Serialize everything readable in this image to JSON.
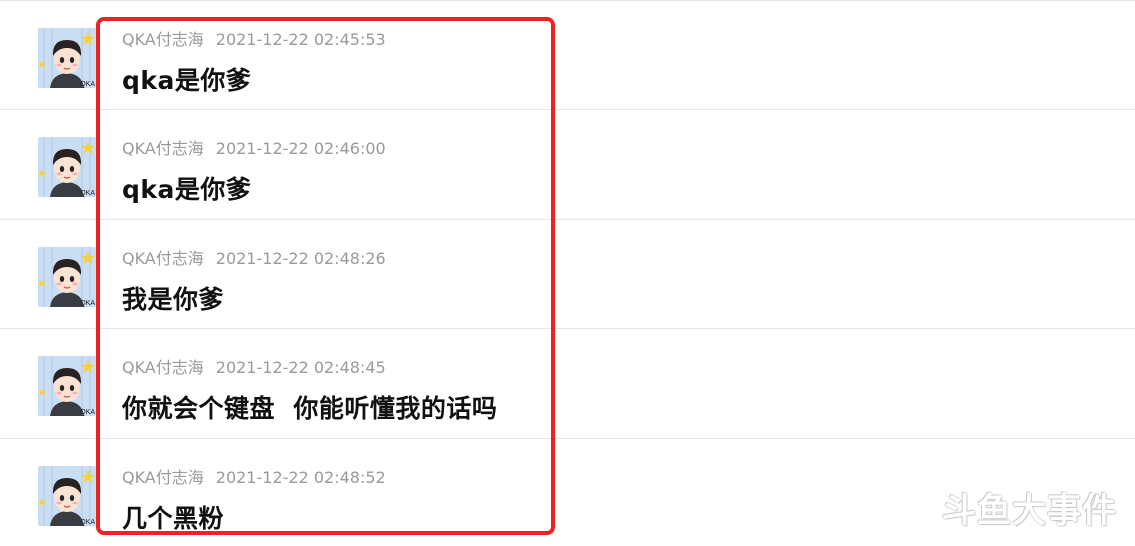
{
  "messages": [
    {
      "sender": "QKA付志海",
      "time": "2021-12-22 02:45:53",
      "text": "qka是你爹"
    },
    {
      "sender": "QKA付志海",
      "time": "2021-12-22 02:46:00",
      "text": "qka是你爹"
    },
    {
      "sender": "QKA付志海",
      "time": "2021-12-22 02:48:26",
      "text": "我是你爹"
    },
    {
      "sender": "QKA付志海",
      "time": "2021-12-22 02:48:45",
      "text": "你就会个键盘  你能听懂我的话吗"
    },
    {
      "sender": "QKA付志海",
      "time": "2021-12-22 02:48:52",
      "text": "几个黑粉"
    }
  ],
  "avatar_caption": "QKA",
  "watermark": "斗鱼大事件",
  "highlight_color": "#ec2326"
}
